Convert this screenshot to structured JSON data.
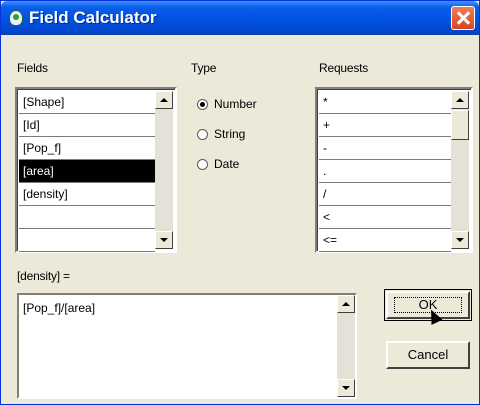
{
  "window": {
    "title": "Field Calculator"
  },
  "fields": {
    "label": "Fields",
    "items": [
      "[Shape]",
      "[Id]",
      "[Pop_f]",
      "[area]",
      "[density]",
      "",
      ""
    ],
    "selected_index": 3
  },
  "type": {
    "label": "Type",
    "options": [
      "Number",
      "String",
      "Date"
    ],
    "selected": "Number"
  },
  "requests": {
    "label": "Requests",
    "items": [
      "*",
      "+",
      "-",
      ".",
      "/",
      "<",
      "<="
    ]
  },
  "expression": {
    "label": "[density] =",
    "value": "[Pop_f]/[area]"
  },
  "buttons": {
    "ok": "OK",
    "cancel": "Cancel"
  }
}
